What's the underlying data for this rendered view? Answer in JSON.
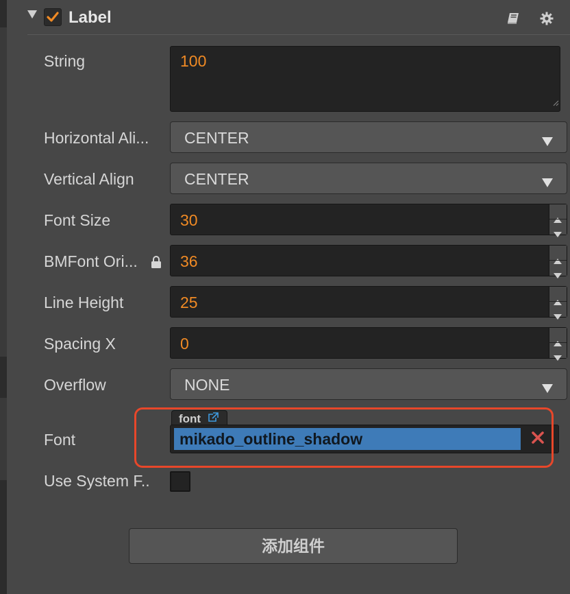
{
  "component": {
    "title": "Label",
    "enabled": true,
    "icons": {
      "fold": "triangle-down-icon",
      "help": "book-icon",
      "settings": "gear-icon"
    }
  },
  "properties": {
    "string": {
      "label": "String",
      "value": "100"
    },
    "horizontal_align": {
      "label": "Horizontal Ali...",
      "value": "CENTER"
    },
    "vertical_align": {
      "label": "Vertical Align",
      "value": "CENTER"
    },
    "font_size": {
      "label": "Font Size",
      "value": "30"
    },
    "bmfont_original_size": {
      "label": "BMFont Ori...",
      "value": "36",
      "locked": true
    },
    "line_height": {
      "label": "Line Height",
      "value": "25"
    },
    "spacing_x": {
      "label": "Spacing X",
      "value": "0"
    },
    "overflow": {
      "label": "Overflow",
      "value": "NONE"
    },
    "font": {
      "label": "Font",
      "asset_type": "font",
      "value": "mikado_outline_shadow"
    },
    "use_system_font": {
      "label": "Use System F..",
      "checked": false
    }
  },
  "add_component_label": "添加组件",
  "colors": {
    "panel": "#474747",
    "value_text": "#f08a24",
    "check_accent": "#f08a24",
    "selection": "#3e7bb8",
    "highlight_outline": "#e8472a",
    "clear_icon": "#d9534f"
  }
}
